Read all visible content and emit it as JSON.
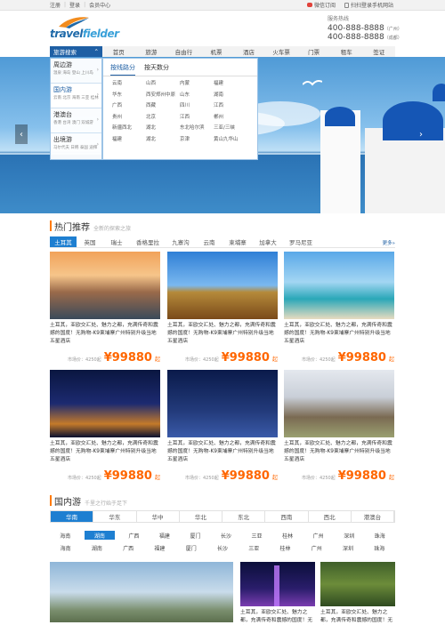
{
  "topbar": {
    "login": "注册",
    "register": "登录",
    "member": "会员中心",
    "weibo": "微信订阅",
    "mobile": "扫扫登录手机网站"
  },
  "logo": {
    "part1": "travel",
    "part2": "fielder"
  },
  "hotline": {
    "label": "服务热线",
    "phones": [
      {
        "number": "400-888-8888",
        "city": "（广州）"
      },
      {
        "number": "400-888-8888",
        "city": "（成都）"
      }
    ]
  },
  "nav": {
    "side_button": "旅游搜索",
    "items": [
      "首页",
      "旅游",
      "自由行",
      "机票",
      "酒店",
      "火车票",
      "门票",
      "租车",
      "签证"
    ]
  },
  "sidemenu": [
    {
      "title": "周边游",
      "sub": "温泉 海岛  登山 上川岛"
    },
    {
      "title": "国内游",
      "sub": "云南 北京  海南 三亚 桂林"
    },
    {
      "title": "港澳台",
      "sub": "香港 台湾  澳门 双城游"
    },
    {
      "title": "出境游",
      "sub": "马尔代夫 日韩  泰国 迪拜"
    }
  ],
  "dropdown": {
    "tabs": [
      "按线路分",
      "按天数分"
    ],
    "cells": [
      "云南",
      "山西",
      "内蒙",
      "福建",
      "华东",
      "西安郑州中原",
      "山东",
      "湖南",
      "广西",
      "西藏",
      "四川",
      "江西",
      "贵州",
      "北京",
      "江西",
      "郴州",
      "新疆西北",
      "湖北",
      "东北哈尔滨",
      "三亚/三峡",
      "福建",
      "湖北",
      "京津",
      "黄山九华山"
    ]
  },
  "banner": {
    "prev": "‹",
    "next": "›"
  },
  "hot": {
    "title": "热门推荐",
    "subtitle": "全新的探索之旅",
    "more": "更多»",
    "filters": [
      "土耳其",
      "英国",
      "瑞士",
      "香格里拉",
      "九寨沟",
      "云南",
      "柬埔寨",
      "加拿大",
      "罗马尼亚"
    ],
    "cards": [
      {
        "desc": "土耳其，亚欧交汇处、魅力之都，充满传奇和震撼的国度！无购物-K9柬埔寨广州特别升级当地五星酒店",
        "market": "市场价：4250起",
        "price": "¥99880",
        "unit": "起"
      },
      {
        "desc": "土耳其，亚欧交汇处、魅力之都，充满传奇和震撼的国度！无购物-K9柬埔寨广州特别升级当地五星酒店",
        "market": "市场价：4250起",
        "price": "¥99880",
        "unit": "起"
      },
      {
        "desc": "土耳其，亚欧交汇处、魅力之都，充满传奇和震撼的国度！无购物-K9柬埔寨广州特别升级当地五星酒店",
        "market": "市场价：4250起",
        "price": "¥99880",
        "unit": "起"
      },
      {
        "desc": "土耳其，亚欧交汇处、魅力之都，充满传奇和震撼的国度！无购物-K9柬埔寨广州特别升级当地五星酒店",
        "market": "市场价：4250起",
        "price": "¥99880",
        "unit": "起"
      },
      {
        "desc": "土耳其，亚欧交汇处、魅力之都，充满传奇和震撼的国度！无购物-K9柬埔寨广州特别升级当地五星酒店",
        "market": "市场价：4250起",
        "price": "¥99880",
        "unit": "起"
      },
      {
        "desc": "土耳其，亚欧交汇处、魅力之都，充满传奇和震撼的国度！无购物-K9柬埔寨广州特别升级当地五星酒店",
        "market": "市场价：4250起",
        "price": "¥99880",
        "unit": "起"
      }
    ]
  },
  "domestic": {
    "title": "国内游",
    "subtitle": "千里之行始于足下",
    "regions": [
      "华南",
      "华东",
      "华中",
      "华北",
      "东北",
      "西南",
      "西北",
      "港澳台"
    ],
    "cities1": [
      "海南",
      "湖南",
      "广西",
      "福建",
      "厦门",
      "长沙",
      "三亚",
      "桂林",
      "广州",
      "深圳",
      "珠海"
    ],
    "cities2": [
      "海南",
      "湖南",
      "广西",
      "福建",
      "厦门",
      "长沙",
      "三亚",
      "桂林",
      "广州",
      "深圳",
      "珠海"
    ],
    "bottom_cards": [
      {
        "desc": "土耳其，亚欧交汇处、魅力之都，充满传奇和震撼的国度！无购物"
      },
      {
        "desc": "土耳其，亚欧交汇处、魅力之都，充满传奇和震撼的国度！无购物"
      }
    ]
  },
  "colors": {
    "brand": "#1e5fa4",
    "accent": "#ff6600",
    "tab_active": "#1e7fd1"
  }
}
